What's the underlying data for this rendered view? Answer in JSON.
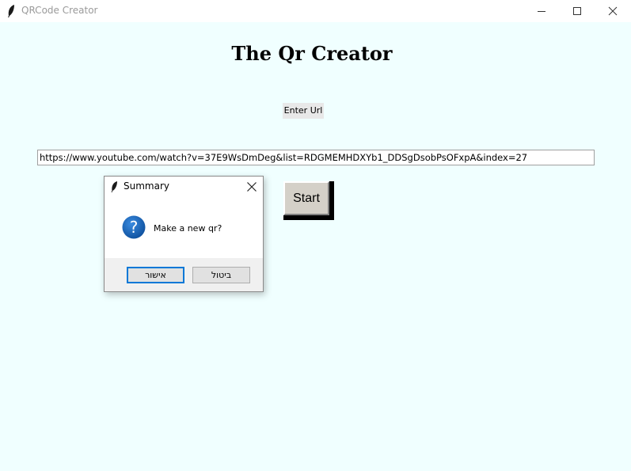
{
  "window": {
    "title": "QRCode Creator",
    "app_icon": "feather-icon",
    "controls": [
      "minimize-icon",
      "maximize-icon",
      "close-icon"
    ]
  },
  "main": {
    "heading": "The Qr Creator",
    "url_label": "Enter Url",
    "url_value": "https://www.youtube.com/watch?v=37E9WsDmDeg&list=RDGMEMHDXYb1_DDSgDsobPsOFxpA&index=27",
    "start_button": "Start"
  },
  "dialog": {
    "title": "Summary",
    "icon": "question-icon",
    "message": "Make a new qr?",
    "ok_label": "אישור",
    "cancel_label": "ביטול"
  },
  "colors": {
    "background": "#f0ffff",
    "accent": "#0078d7",
    "question_icon": "#1565c0"
  }
}
